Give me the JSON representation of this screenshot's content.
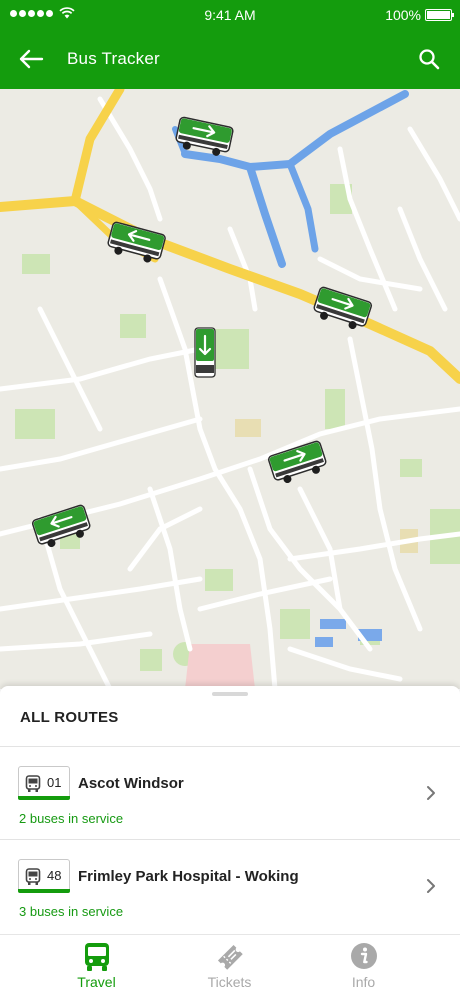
{
  "status_bar": {
    "time": "9:41 AM",
    "battery": "100%"
  },
  "header": {
    "title": "Bus Tracker",
    "back_icon": "arrow-left-icon",
    "search_icon": "search-icon"
  },
  "map": {
    "buses": [
      {
        "id": "bus-1",
        "direction": "right"
      },
      {
        "id": "bus-2",
        "direction": "left"
      },
      {
        "id": "bus-3",
        "direction": "right"
      },
      {
        "id": "bus-4",
        "direction": "down"
      },
      {
        "id": "bus-5",
        "direction": "right"
      },
      {
        "id": "bus-6",
        "direction": "left"
      }
    ]
  },
  "sheet": {
    "title": "ALL ROUTES",
    "routes": [
      {
        "number": "01",
        "name": "Ascot Windsor",
        "status": "2 buses in service"
      },
      {
        "number": "48",
        "name": "Frimley Park Hospital - Woking",
        "status": "3 buses in service"
      }
    ]
  },
  "tabs": [
    {
      "label": "Travel",
      "icon": "bus-icon",
      "active": true
    },
    {
      "label": "Tickets",
      "icon": "ticket-icon",
      "active": false
    },
    {
      "label": "Info",
      "icon": "info-icon",
      "active": false
    }
  ],
  "colors": {
    "brand": "#149c0d",
    "road_main": "#f7d24a",
    "water": "#6da3e8",
    "park": "#cde5b5",
    "map_bg": "#ecebe4"
  }
}
